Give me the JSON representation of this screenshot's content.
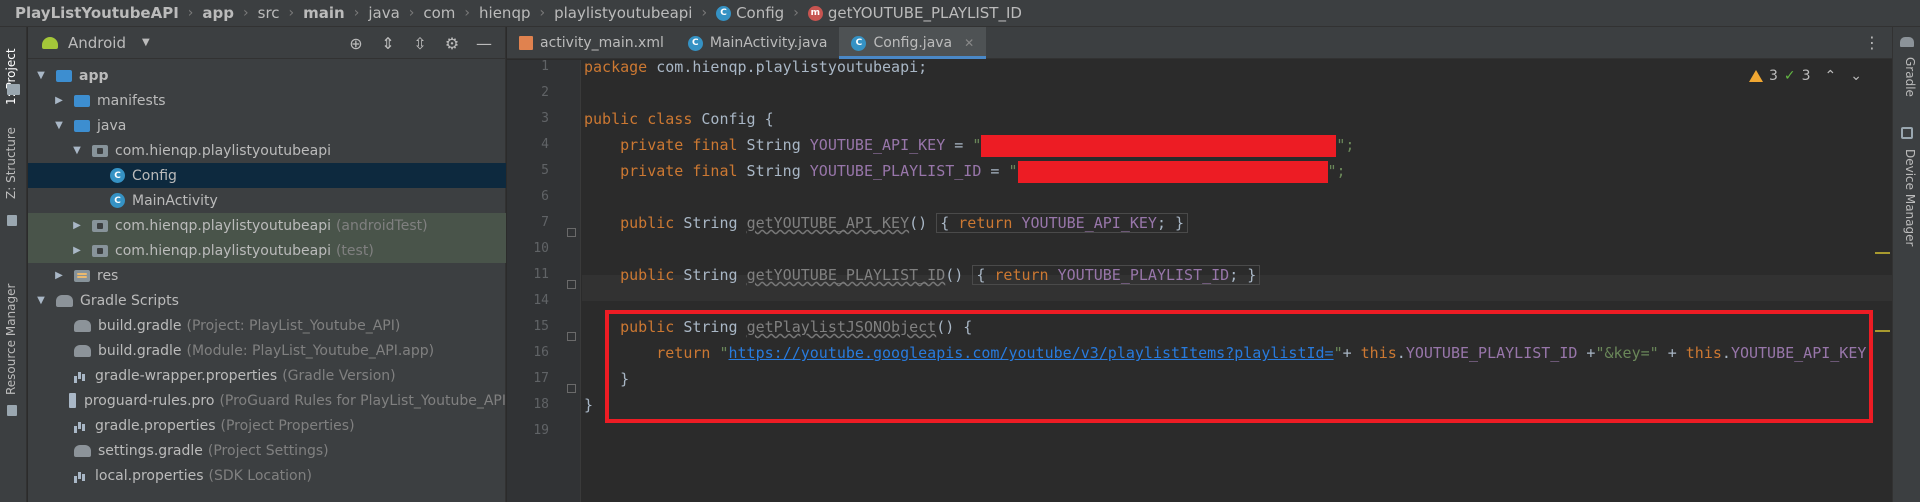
{
  "breadcrumb": [
    {
      "label": "PlayListYoutubeAPI",
      "bold": true
    },
    {
      "label": "app",
      "bold": true
    },
    {
      "label": "src",
      "bold": false
    },
    {
      "label": "main",
      "bold": true
    },
    {
      "label": "java",
      "bold": false
    },
    {
      "label": "com",
      "bold": false
    },
    {
      "label": "hienqp",
      "bold": false
    },
    {
      "label": "playlistyoutubeapi",
      "bold": false
    },
    {
      "label": "Config",
      "bold": false,
      "icon": "class-icon"
    },
    {
      "label": "getYOUTUBE_PLAYLIST_ID",
      "bold": false,
      "icon": "method-icon"
    }
  ],
  "left_strip": {
    "project_tab": "1: Project",
    "structure_tab": "Z: Structure",
    "resource_tab": "Resource Manager"
  },
  "project_panel": {
    "view_selector": "Android",
    "tree": [
      {
        "label": "app",
        "hint": "",
        "depth": 0,
        "expanded": true,
        "icon": "app-folder-icon",
        "bold": true
      },
      {
        "label": "manifests",
        "hint": "",
        "depth": 1,
        "expanded": false,
        "icon": "folder-icon"
      },
      {
        "label": "java",
        "hint": "",
        "depth": 1,
        "expanded": true,
        "icon": "folder-icon"
      },
      {
        "label": "com.hienqp.playlistyoutubeapi",
        "hint": "",
        "depth": 2,
        "expanded": true,
        "icon": "package-icon"
      },
      {
        "label": "Config",
        "hint": "",
        "depth": 3,
        "icon": "class-icon",
        "selected": true
      },
      {
        "label": "MainActivity",
        "hint": "",
        "depth": 3,
        "icon": "class-icon"
      },
      {
        "label": "com.hienqp.playlistyoutubeapi",
        "hint": "(androidTest)",
        "depth": 2,
        "expanded": false,
        "icon": "package-icon",
        "test": true
      },
      {
        "label": "com.hienqp.playlistyoutubeapi",
        "hint": "(test)",
        "depth": 2,
        "expanded": false,
        "icon": "package-icon",
        "test": true
      },
      {
        "label": "res",
        "hint": "",
        "depth": 1,
        "expanded": false,
        "icon": "res-folder-icon"
      },
      {
        "label": "Gradle Scripts",
        "hint": "",
        "depth": 0,
        "expanded": true,
        "icon": "gradle-icon"
      },
      {
        "label": "build.gradle",
        "hint": "(Project: PlayList_Youtube_API)",
        "depth": 1,
        "icon": "gradle-icon"
      },
      {
        "label": "build.gradle",
        "hint": "(Module: PlayList_Youtube_API.app)",
        "depth": 1,
        "icon": "gradle-icon"
      },
      {
        "label": "gradle-wrapper.properties",
        "hint": "(Gradle Version)",
        "depth": 1,
        "icon": "properties-icon"
      },
      {
        "label": "proguard-rules.pro",
        "hint": "(ProGuard Rules for PlayList_Youtube_API",
        "depth": 1,
        "icon": "file-icon"
      },
      {
        "label": "gradle.properties",
        "hint": "(Project Properties)",
        "depth": 1,
        "icon": "properties-icon"
      },
      {
        "label": "settings.gradle",
        "hint": "(Project Settings)",
        "depth": 1,
        "icon": "gradle-icon"
      },
      {
        "label": "local.properties",
        "hint": "(SDK Location)",
        "depth": 1,
        "icon": "properties-icon"
      }
    ]
  },
  "editor": {
    "tabs": [
      {
        "label": "activity_main.xml",
        "icon": "xml-icon",
        "active": false
      },
      {
        "label": "MainActivity.java",
        "icon": "class-icon",
        "active": false
      },
      {
        "label": "Config.java",
        "icon": "class-icon",
        "active": true
      }
    ],
    "inspections": {
      "warnings": "3",
      "weak_warnings": "3"
    },
    "line_numbers": [
      "1",
      "2",
      "3",
      "4",
      "5",
      "6",
      "7",
      "10",
      "11",
      "14",
      "15",
      "16",
      "17",
      "18",
      "19"
    ],
    "code": {
      "l1_kw": "package",
      "l1_rest": " com.hienqp.playlistyoutubeapi;",
      "l3_kw": "public class",
      "l3_rest": " Config {",
      "l4_kw": "    private final",
      "l4_type": " String ",
      "l4_field": "YOUTUBE_API_KEY",
      "l4_eq": " = ",
      "l4_q1": "\"",
      "l4_q2": "\";",
      "l5_kw": "    private final",
      "l5_type": " String ",
      "l5_field": "YOUTUBE_PLAYLIST_ID",
      "l5_eq": " = ",
      "l5_q1": "\"",
      "l5_q2": "\";",
      "l7_kw": "    public",
      "l7_type": " String ",
      "l7_meth": "getYOUTUBE_API_KEY",
      "l7_paren": "() ",
      "l7_open": "{ ",
      "l7_ret": "return ",
      "l7_field": "YOUTUBE_API_KEY",
      "l7_close": "; }",
      "l11_kw": "    public",
      "l11_type": " String ",
      "l11_meth": "getYOUTUBE_PLAYLIST_ID",
      "l11_paren": "() ",
      "l11_open": "{ ",
      "l11_ret": "return ",
      "l11_field": "YOUTUBE_PLAYLIST_ID",
      "l11_close": "; }",
      "l15_kw": "    public",
      "l15_type": " String ",
      "l15_meth": "getPlaylistJSONObject",
      "l15_rest": "() {",
      "l16_ret": "        return ",
      "l16_q1": "\"",
      "l16_url": "https://youtube.googleapis.com/youtube/v3/playlistItems?playlistId=",
      "l16_q2": "\"",
      "l16_plus1": "+ ",
      "l16_this1": "this",
      "l16_dot1": ".",
      "l16_f1": "YOUTUBE_PLAYLIST_ID",
      "l16_plus2": " +",
      "l16_key": "\"&key=\"",
      "l16_plus3": " + ",
      "l16_this2": "this",
      "l16_dot2": ".",
      "l16_f2": "YOUTUBE_API_KEY",
      "l16_semi": ";",
      "l17": "    }",
      "l18": "}"
    }
  },
  "right_strip": {
    "gradle_tab": "Gradle",
    "device_tab": "Device Manager"
  },
  "colors": {
    "highlight_frame": "#ed1c24",
    "redaction": "#ed1c24",
    "keyword": "#cc7832",
    "field": "#9876aa",
    "string": "#6a8759",
    "url": "#287bde"
  }
}
